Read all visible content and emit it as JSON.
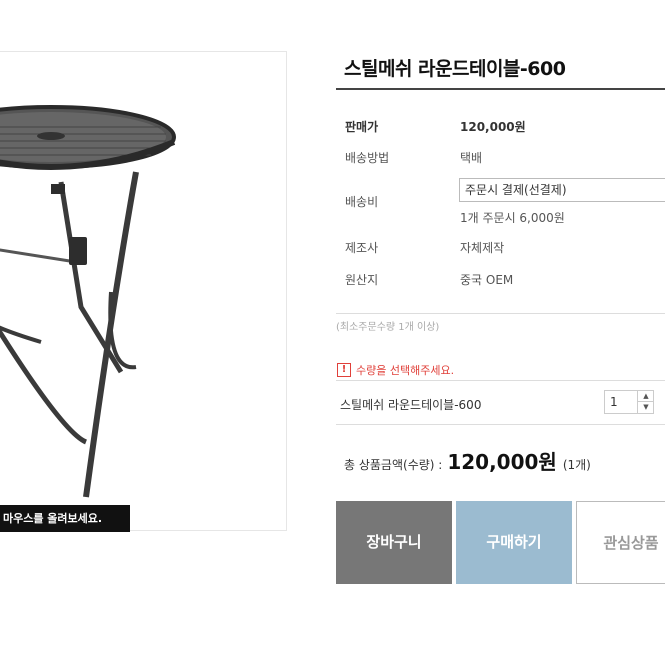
{
  "product": {
    "title": "스틸메쉬 라운드테이블-600",
    "zoom_hint": "마우스를 올려보세요."
  },
  "info_rows": {
    "price": {
      "label": "판매가",
      "value": "120,000원"
    },
    "delivery": {
      "label": "배송방법",
      "value": "택배"
    },
    "shipping_fee": {
      "label": "배송비",
      "select_value": "주문시 결제(선결제)",
      "note": "1개 주문시 6,000원"
    },
    "maker": {
      "label": "제조사",
      "value": "자체제작"
    },
    "origin": {
      "label": "원산지",
      "value": "중국 OEM"
    }
  },
  "min_order": "(최소주문수량 1개 이상)",
  "alert": {
    "icon": "!",
    "text": "수량을 선택해주세요."
  },
  "option": {
    "name": "스틸메쉬 라운드테이블-600",
    "quantity": "1",
    "up": "▲",
    "down": "▼"
  },
  "total": {
    "label": "총 상품금액(수량) :",
    "price": "120,000원",
    "count": "(1개)"
  },
  "buttons": {
    "cart": "장바구니",
    "buy": "구매하기",
    "wish": "관심상품"
  },
  "colors": {
    "cart_bg": "#777777",
    "buy_bg": "#9bbbd0",
    "alert": "#e0403a"
  }
}
